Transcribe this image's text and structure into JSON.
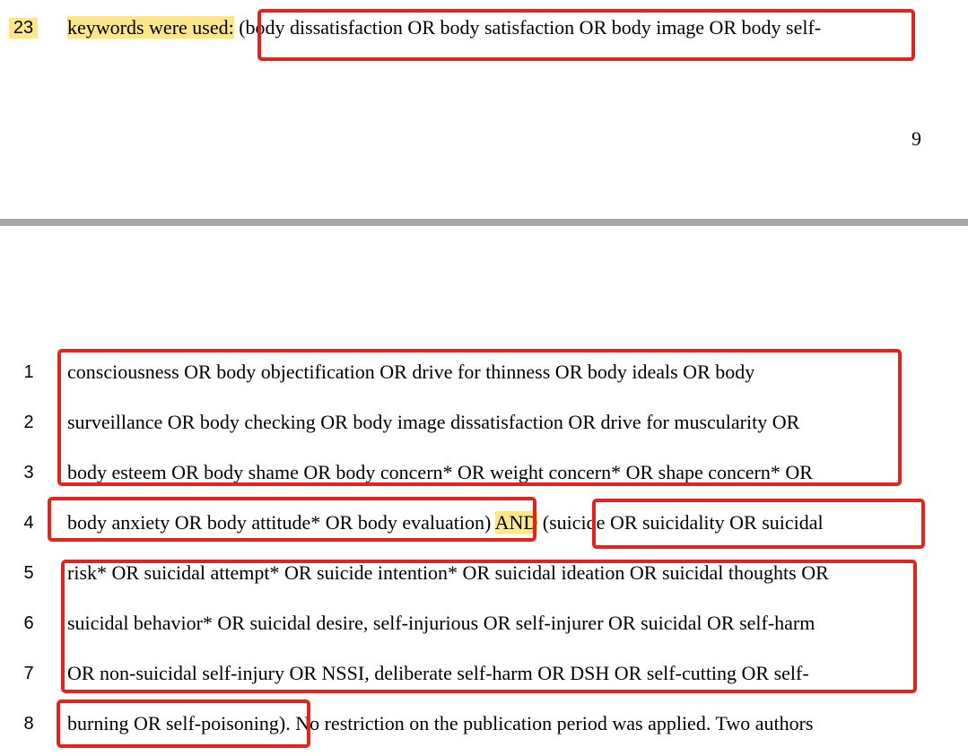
{
  "top_page": {
    "line_number": "23",
    "highlight_text": "keywords were used:",
    "text_rest": " (body dissatisfaction OR body satisfaction OR body image OR body self-",
    "page_number": "9"
  },
  "bottom_page": {
    "lines": [
      {
        "number": "1",
        "text": "consciousness OR body objectification OR drive for thinness OR body ideals OR body"
      },
      {
        "number": "2",
        "text": "surveillance OR body checking OR body image dissatisfaction OR drive for muscularity OR"
      },
      {
        "number": "3",
        "text": "body esteem OR body shame OR body concern* OR weight concern* OR shape concern* OR"
      },
      {
        "number": "4",
        "text_a": "body anxiety OR body attitude* OR body evaluation",
        "text_b": ") ",
        "text_and": "AND",
        "text_c": " (suicide OR suicidality OR suicidal"
      },
      {
        "number": "5",
        "text": "risk* OR suicidal attempt* OR suicide intention* OR suicidal ideation OR suicidal thoughts OR"
      },
      {
        "number": "6",
        "text": "suicidal behavior* OR suicidal desire, self-injurious OR self-injurer OR suicidal OR self-harm"
      },
      {
        "number": "7",
        "text": "OR non-suicidal self-injury OR NSSI, deliberate self-harm OR DSH OR self-cutting OR self-"
      },
      {
        "number": "8",
        "text_a": "burning OR self-poisoning",
        "text_b": "). No restriction on the publication period was applied. Two authors"
      }
    ]
  },
  "colors": {
    "highlight": "#fde68a",
    "annotation_box": "#e3231c",
    "page_separator": "#a6a6a6"
  }
}
